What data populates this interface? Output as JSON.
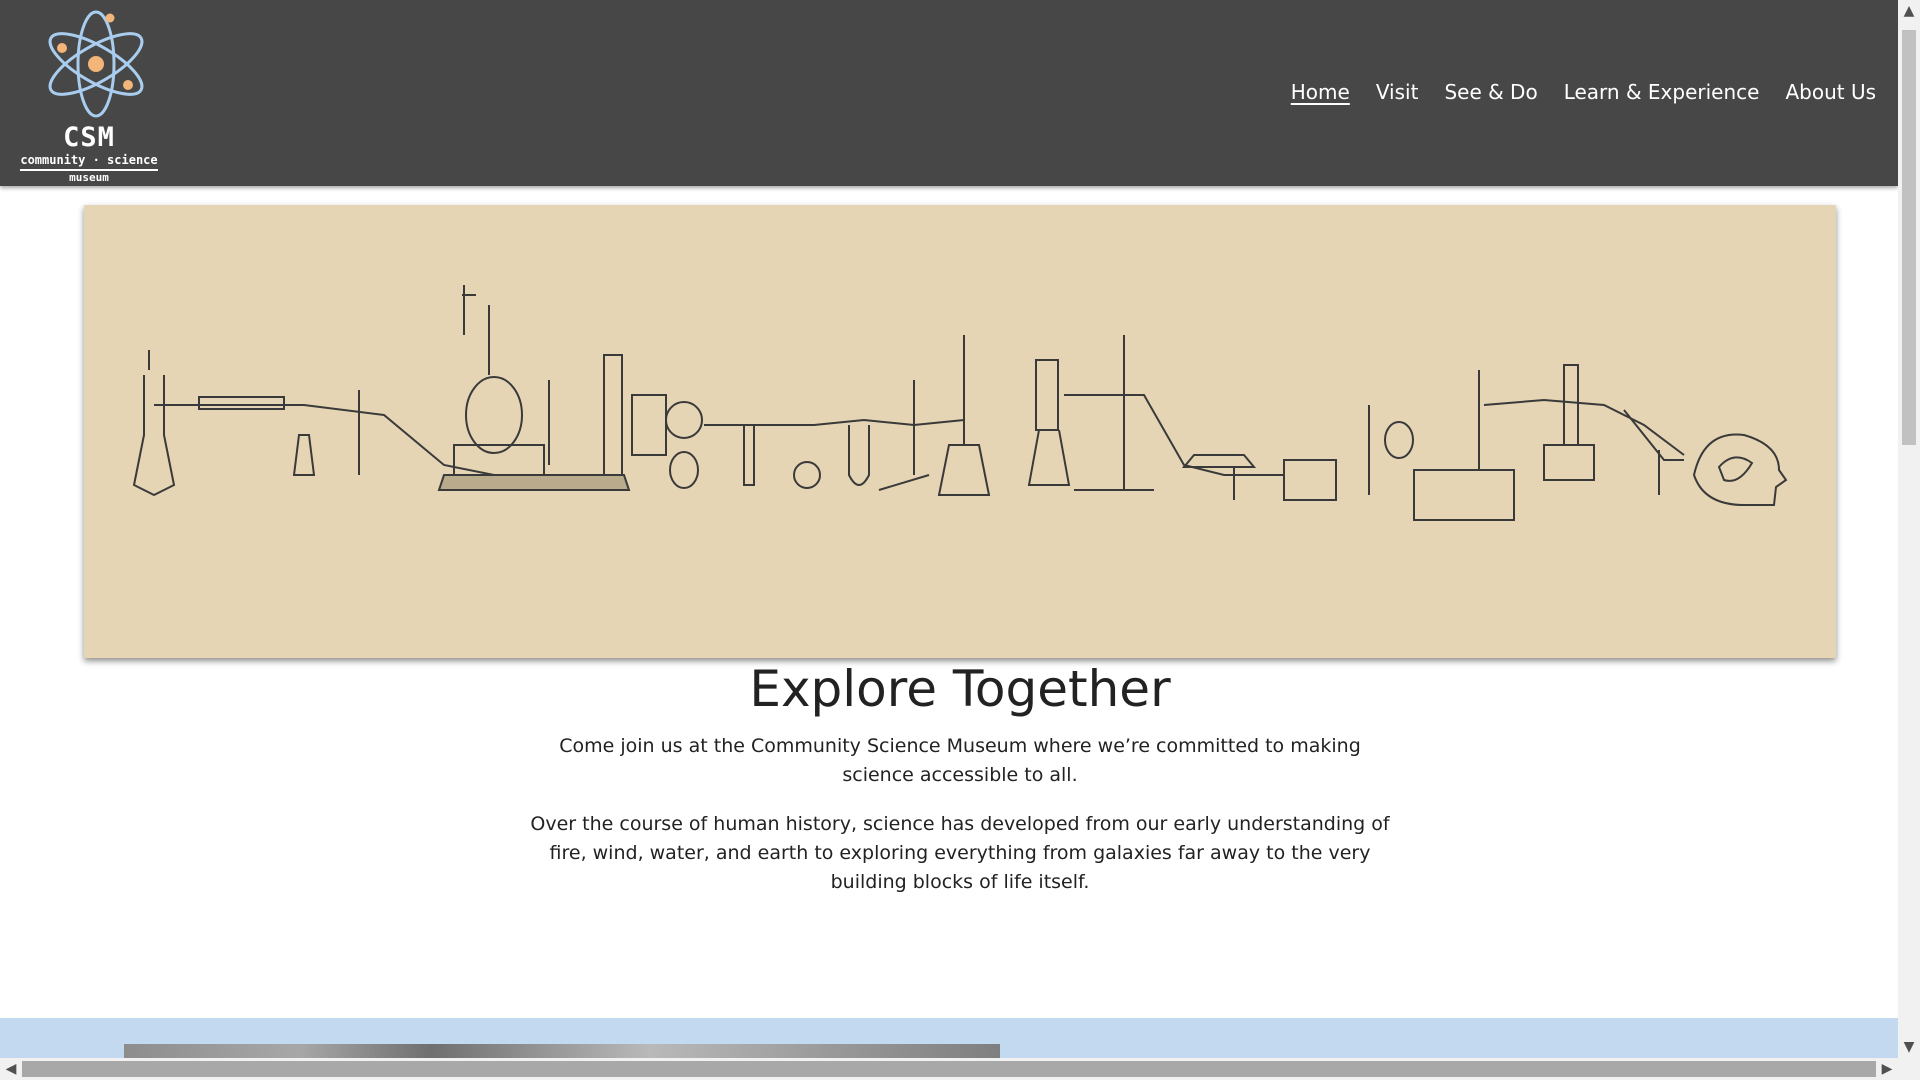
{
  "logo": {
    "abbr": "CSM",
    "line1": "community · science",
    "line2": "museum"
  },
  "nav": [
    {
      "label": "Home",
      "active": true
    },
    {
      "label": "Visit",
      "active": false
    },
    {
      "label": "See & Do",
      "active": false
    },
    {
      "label": "Learn & Experience",
      "active": false
    },
    {
      "label": "About Us",
      "active": false
    }
  ],
  "intro": {
    "heading": "Explore Together",
    "paragraph1": "Come join us at the Community Science Museum where we’re committed to making science accessible to all.",
    "paragraph2": "Over the course of human history, science has developed from our early understanding of fire, wind, water, and earth to exploring everything from galaxies far away to the very building blocks of life itself."
  },
  "colors": {
    "header_bg": "#474747",
    "hero_bg": "#e5d5b4",
    "band_bg": "#c3d9ef",
    "logo_orbit": "#a9cdef",
    "logo_nucleus": "#f2b57a"
  },
  "icons": {
    "logo": "atom-icon",
    "scroll_up": "arrow-up-icon",
    "scroll_down": "arrow-down-icon",
    "scroll_left": "arrow-left-icon",
    "scroll_right": "arrow-right-icon"
  }
}
